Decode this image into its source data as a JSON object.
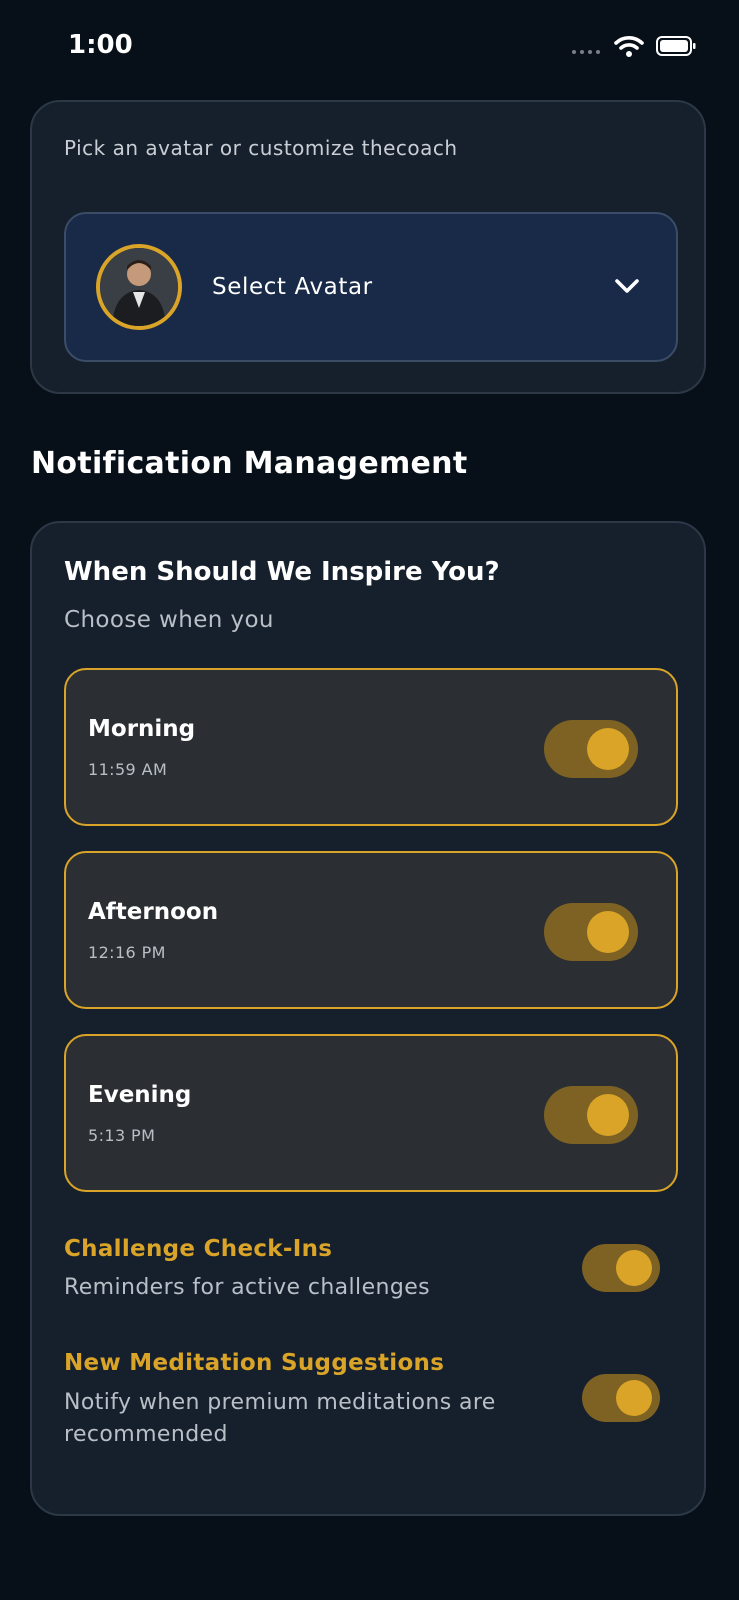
{
  "status_bar": {
    "time": "1:00"
  },
  "avatar": {
    "hint": "Pick an avatar or customize thecoach",
    "select_label": "Select Avatar"
  },
  "notifications": {
    "section_title": "Notification Management",
    "card_title": "When Should We Inspire You?",
    "card_subtitle": "Choose when you",
    "slots": [
      {
        "name": "Morning",
        "time": "11:59 AM",
        "enabled": true
      },
      {
        "name": "Afternoon",
        "time": "12:16 PM",
        "enabled": true
      },
      {
        "name": "Evening",
        "time": "5:13 PM",
        "enabled": true
      }
    ],
    "preferences": [
      {
        "title": "Challenge Check-Ins",
        "description": "Reminders for active challenges",
        "enabled": true
      },
      {
        "title": "New Meditation Suggestions",
        "description": "Notify when premium meditations are recommended",
        "enabled": true
      }
    ]
  },
  "colors": {
    "background": "#070f18",
    "card": "#16202d",
    "accent": "#d9a427",
    "toggle_track": "#7d6223",
    "select_bg": "#182a48"
  },
  "icons": [
    "cellular-dots-icon",
    "wifi-icon",
    "battery-icon",
    "chevron-down-icon"
  ]
}
